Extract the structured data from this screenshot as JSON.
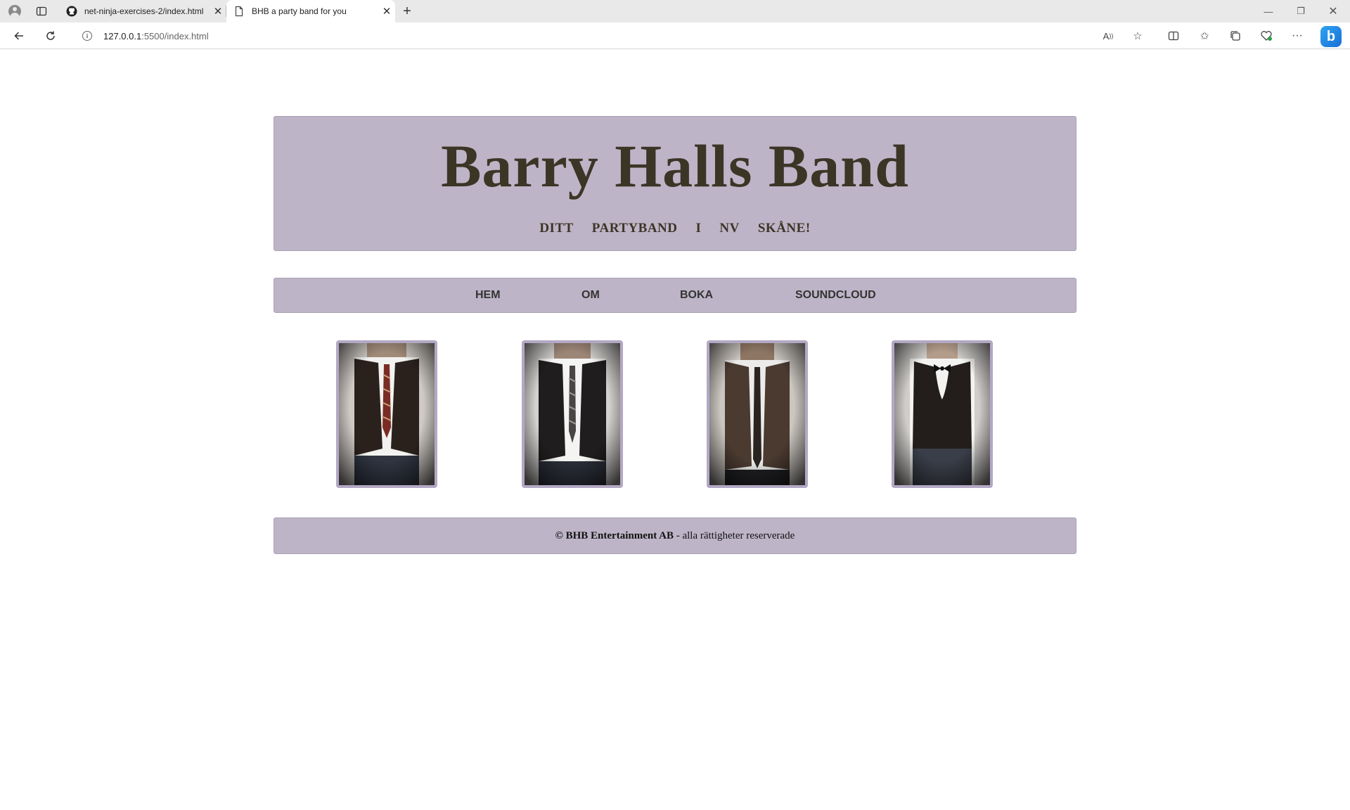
{
  "browser": {
    "tabs": [
      {
        "title": "net-ninja-exercises-2/index.html",
        "active": false,
        "icon": "github-icon"
      },
      {
        "title": "BHB a party band for you",
        "active": true,
        "icon": "page-icon"
      }
    ],
    "address": {
      "host": "127.0.0.1",
      "rest": ":5500/index.html"
    }
  },
  "site": {
    "title": "Barry Halls Band",
    "tagline": [
      "DITT",
      "PARTYBAND",
      "I",
      "NV",
      "SKÅNE!"
    ],
    "nav": [
      "HEM",
      "OM",
      "BOKA",
      "SOUNDCLOUD"
    ],
    "photos": [
      {
        "tie": "striped-red-tie",
        "vest": "dark-vest"
      },
      {
        "tie": "striped-grey-tie",
        "vest": "dark-vest"
      },
      {
        "tie": "plain-dark-tie",
        "vest": "brown-vest"
      },
      {
        "tie": "bow-tie",
        "vest": "black-vest"
      }
    ],
    "footer": {
      "company": "© BHB Entertainment AB",
      "rest": " - alla rättigheter reserverade"
    },
    "colors": {
      "panel": "#bdb4c7",
      "photo_border": "#b3a8c4",
      "title_text": "#3b3526"
    }
  }
}
